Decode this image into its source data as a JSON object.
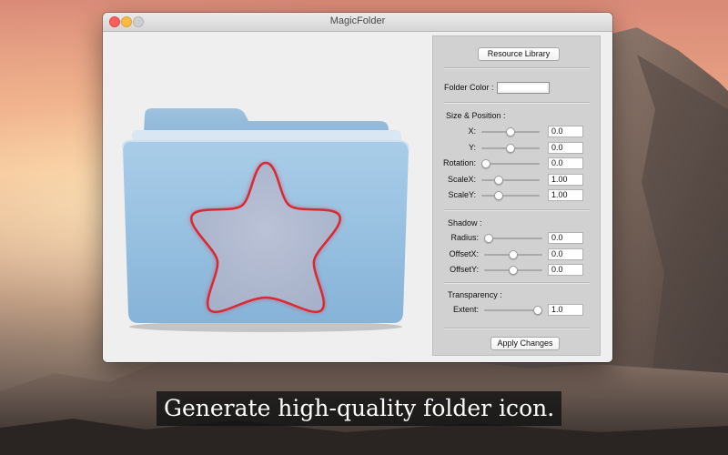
{
  "window": {
    "title": "MagicFolder"
  },
  "panel": {
    "resource_library_label": "Resource Library",
    "folder_color_label": "Folder Color :",
    "folder_color_value": "#ffffff",
    "size_position_heading": "Size & Position :",
    "size_position": [
      {
        "label": "X:",
        "value": "0.0",
        "level": 0.5
      },
      {
        "label": "Y:",
        "value": "0.0",
        "level": 0.5
      },
      {
        "label": "Rotation:",
        "value": "0.0",
        "level": 0.0
      },
      {
        "label": "ScaleX:",
        "value": "1.00",
        "level": 0.25
      },
      {
        "label": "ScaleY:",
        "value": "1.00",
        "level": 0.25
      }
    ],
    "shadow_heading": "Shadow :",
    "shadow": [
      {
        "label": "Radius:",
        "value": "0.0",
        "level": 0.0
      },
      {
        "label": "OffsetX:",
        "value": "0.0",
        "level": 0.5
      },
      {
        "label": "OffsetY:",
        "value": "0.0",
        "level": 0.5
      }
    ],
    "transparency_heading": "Transparency :",
    "transparency": [
      {
        "label": "Extent:",
        "value": "1.0",
        "level": 1.0
      }
    ],
    "apply_label": "Apply Changes"
  },
  "caption": "Generate high-quality folder icon.",
  "colors": {
    "folder_blue": "#9cc3e2",
    "star_outline": "#e0303a",
    "close": "#fc605c",
    "minimize": "#fdbc40"
  }
}
